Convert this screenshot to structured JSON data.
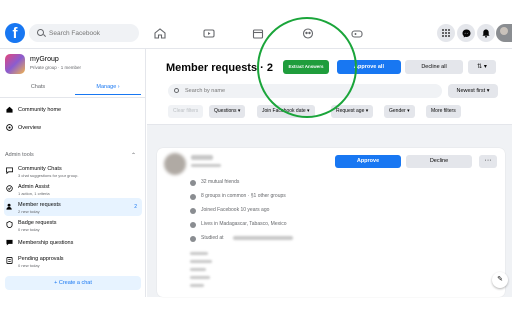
{
  "topbar": {
    "logo": "f",
    "search_placeholder": "Search Facebook",
    "icons": [
      "home-icon",
      "watch-icon",
      "marketplace-icon",
      "groups-icon",
      "gaming-icon",
      "menu-grid-icon",
      "messenger-icon",
      "notifications-icon",
      "profile-avatar"
    ]
  },
  "group": {
    "name": "myGroup",
    "meta": "Private group · 1 member"
  },
  "sidebar": {
    "tabs": [
      {
        "label": "Chats",
        "active": false
      },
      {
        "label": "Manage ›",
        "active": true
      }
    ],
    "top_items": [
      {
        "label": "Community home",
        "icon": "community-home-icon"
      },
      {
        "label": "Overview",
        "icon": "overview-icon"
      }
    ],
    "section_title": "Admin tools",
    "section_chevron": "⌃",
    "admin_items": [
      {
        "label": "Community Chats",
        "sub": "3 chat suggestions for your group.",
        "icon": "community-chats-icon"
      },
      {
        "label": "Admin Assist",
        "sub": "1 action, 1 criteria",
        "icon": "admin-assist-icon"
      },
      {
        "label": "Member requests",
        "sub": "2 new today",
        "count": "2",
        "active": true,
        "icon": "member-requests-icon"
      },
      {
        "label": "Badge requests",
        "sub": "0 new today",
        "icon": "badge-requests-icon"
      },
      {
        "label": "Membership questions",
        "sub": "",
        "icon": "membership-questions-icon"
      },
      {
        "label": "Pending approvals",
        "sub": "0 new today",
        "icon": "pending-approvals-icon"
      }
    ],
    "create_chat": "+ Create a chat"
  },
  "main": {
    "title": "Member requests · 2",
    "extract_answers": "Extract Answers",
    "approve_all": "Approve all",
    "decline_all": "Decline all",
    "more_options": "⇅ ▾",
    "search_placeholder": "Search by name",
    "sort": "Newest first ▾",
    "filters": [
      {
        "label": "Clear filters",
        "disabled": true
      },
      {
        "label": "Questions ▾",
        "disabled": false
      },
      {
        "label": "Join Facebook date ▾",
        "disabled": false
      },
      {
        "label": "Request age ▾",
        "disabled": false
      },
      {
        "label": "Gender ▾",
        "disabled": false
      },
      {
        "label": "More filters",
        "disabled": false
      }
    ]
  },
  "request": {
    "approve": "Approve",
    "decline": "Decline",
    "more": "···",
    "details": [
      {
        "text": "32 mutual friends",
        "icon": "friends-icon"
      },
      {
        "text": "8 groups in common · §1 other groups",
        "icon": "groups-common-icon"
      },
      {
        "text": "Joined Facebook 10 years ago",
        "icon": "facebook-joined-icon"
      },
      {
        "text": "Lives in Madagascar, Tabasco, Mexico",
        "icon": "home-location-icon"
      },
      {
        "text": "Studied at",
        "icon": "education-icon"
      }
    ]
  },
  "colors": {
    "brand": "#1877f2",
    "extract_button": "#1f9d3c",
    "annotation_circle": "#1aa53a"
  }
}
